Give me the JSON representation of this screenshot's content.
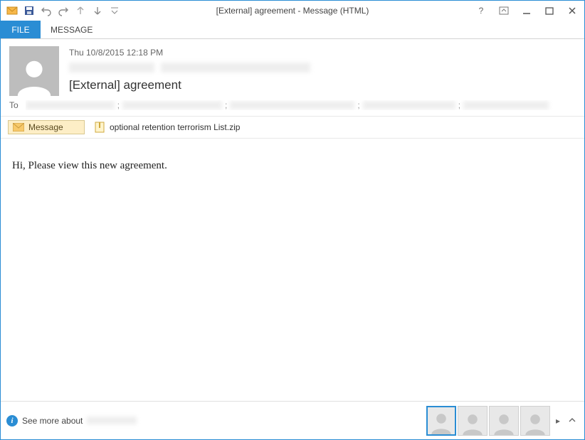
{
  "window": {
    "title": "[External] agreement - Message (HTML)"
  },
  "ribbon": {
    "file": "FILE",
    "message": "MESSAGE"
  },
  "header": {
    "date": "Thu 10/8/2015 12:18 PM",
    "subject": "[External] agreement",
    "to_label": "To"
  },
  "attachments": {
    "message_label": "Message",
    "file_name": "optional retention terrorism List.zip"
  },
  "body": {
    "text": "Hi, Please view this new agreement."
  },
  "status": {
    "see_more": "See more about "
  },
  "icons": {
    "envelope": "envelope-icon",
    "save": "save-icon",
    "undo": "undo-icon",
    "redo": "redo-icon",
    "up": "up-arrow-icon",
    "down": "down-arrow-icon",
    "customize": "customize-qat-icon",
    "help": "help-icon",
    "ribbon_toggle": "ribbon-toggle-icon",
    "minimize": "minimize-icon",
    "maximize": "maximize-icon",
    "close": "close-icon",
    "zip": "zip-icon",
    "info": "info-icon",
    "pager_next": "pager-next-icon",
    "expand_up": "expand-up-icon"
  }
}
